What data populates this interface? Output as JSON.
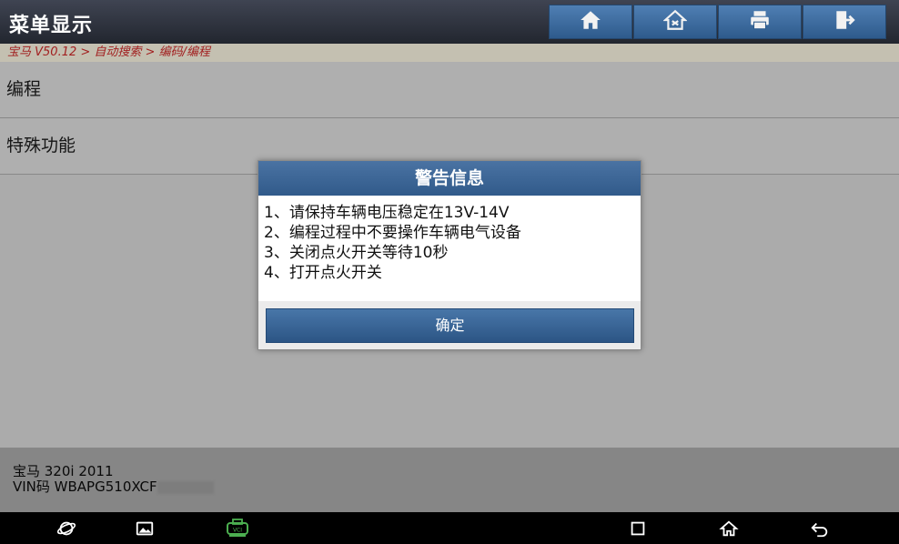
{
  "header": {
    "title": "菜单显示",
    "buttons": [
      {
        "name": "home",
        "icon": "home-icon"
      },
      {
        "name": "diag-home",
        "icon": "diagnostic-home-icon"
      },
      {
        "name": "print",
        "icon": "printer-icon"
      },
      {
        "name": "exit",
        "icon": "exit-icon"
      }
    ]
  },
  "breadcrumb": "宝马 V50.12 > 自动搜索 > 编码/编程",
  "menu": {
    "items": [
      {
        "label": "编程"
      },
      {
        "label": "特殊功能"
      }
    ]
  },
  "dialog": {
    "title": "警告信息",
    "lines": [
      "1、请保持车辆电压稳定在13V-14V",
      "2、编程过程中不要操作车辆电气设备",
      "3、关闭点火开关等待10秒",
      "4、打开点火开关"
    ],
    "confirm_label": "确定"
  },
  "vehicle": {
    "model": "宝马 320i 2011",
    "vin": "VIN码 WBAPG510XCF"
  },
  "navbar": {
    "icons": [
      "browser-icon",
      "gallery-icon",
      "vci-icon",
      "recent-apps-icon",
      "android-home-icon",
      "back-icon"
    ],
    "vci_label": "VCI"
  },
  "colors": {
    "accent": "#3a6699",
    "breadcrumb_text": "#c62828",
    "vci_green": "#4caf50"
  }
}
